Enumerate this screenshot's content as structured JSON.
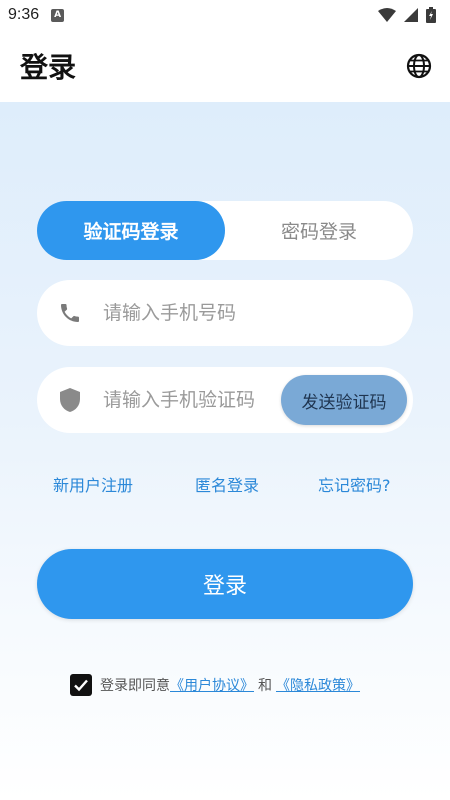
{
  "status_bar": {
    "time": "9:36",
    "notification_icon": "A"
  },
  "app_bar": {
    "title": "登录",
    "globe_icon": "globe-icon"
  },
  "tabs": [
    {
      "label": "验证码登录",
      "active": true
    },
    {
      "label": "密码登录",
      "active": false
    }
  ],
  "phone_field": {
    "placeholder": "请输入手机号码",
    "icon": "phone-icon"
  },
  "code_field": {
    "placeholder": "请输入手机验证码",
    "icon": "shield-icon",
    "send_code_label": "发送验证码"
  },
  "links": {
    "register": "新用户注册",
    "anonymous": "匿名登录",
    "forgot": "忘记密码?"
  },
  "login_button": "登录",
  "agreement": {
    "checked": true,
    "prefix": "登录即同意",
    "user_agreement": "《用户协议》",
    "and": "和",
    "privacy_policy": "《隐私政策》"
  },
  "colors": {
    "primary": "#2f97ee",
    "send_code_bg": "#7aa9d6",
    "link": "#2b88d8"
  }
}
